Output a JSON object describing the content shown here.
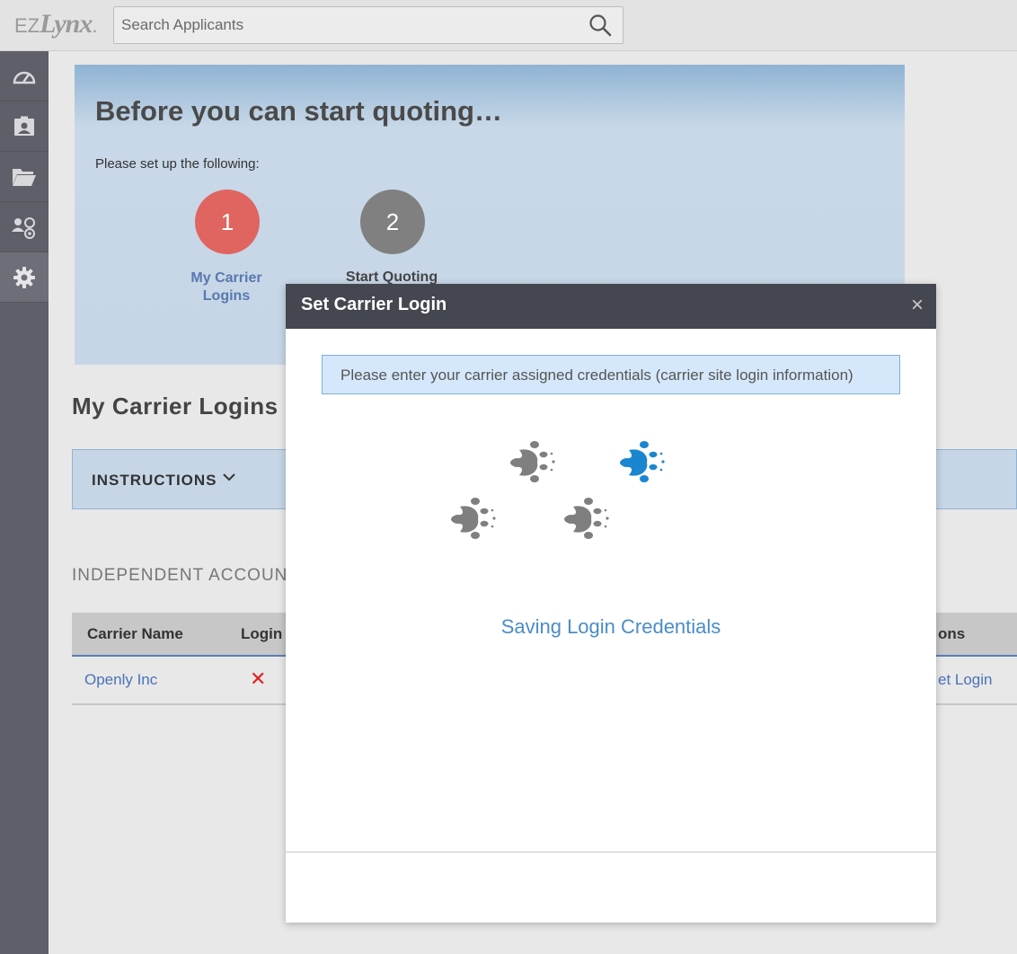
{
  "app": {
    "logo_ez": "EZ",
    "logo_lynx": "Lynx",
    "logo_dot": "."
  },
  "search": {
    "placeholder": "Search Applicants"
  },
  "sidebar": {
    "items": [
      {
        "icon": "dashboard-icon"
      },
      {
        "icon": "contact-card-icon"
      },
      {
        "icon": "folder-icon"
      },
      {
        "icon": "users-icon"
      },
      {
        "icon": "gear-icon",
        "active": true
      }
    ]
  },
  "banner": {
    "title": "Before you can start quoting…",
    "subtitle": "Please set up the following:",
    "steps": [
      {
        "number": "1",
        "label": "My Carrier Logins",
        "color": "#e06560"
      },
      {
        "number": "2",
        "label": "Start Quoting",
        "color": "#808080"
      }
    ]
  },
  "section": {
    "title": "My Carrier Logins",
    "instructions_label": "INSTRUCTIONS",
    "independent_label": "INDEPENDENT ACCOUN"
  },
  "table": {
    "headers": [
      "Carrier Name",
      "Login",
      "ons"
    ],
    "rows": [
      {
        "carrier": "Openly Inc",
        "login_status": "✕",
        "action": "et Login"
      }
    ]
  },
  "modal": {
    "title": "Set Carrier Login",
    "close": "×",
    "info": "Please enter your carrier assigned credentials (carrier site login information)",
    "status": "Saving Login Credentials",
    "accent_color": "#1a86cf"
  }
}
